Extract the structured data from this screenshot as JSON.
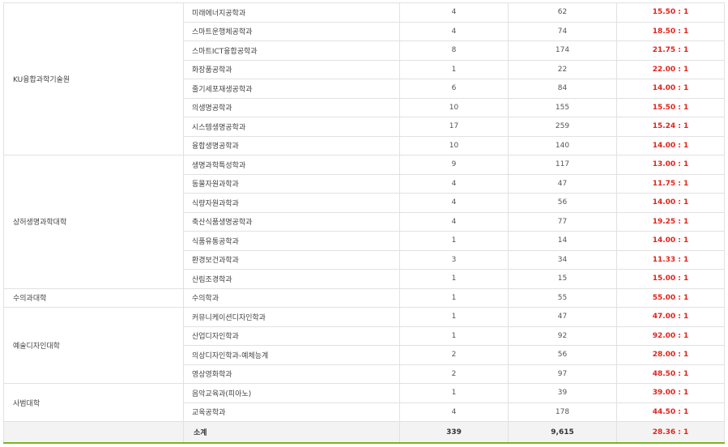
{
  "groups": [
    {
      "college": "KU융합과학기술원",
      "rows": [
        {
          "dept": "미래에너지공학과",
          "quota": "4",
          "applicants": "62",
          "ratio": "15.50 : 1"
        },
        {
          "dept": "스마트운행체공학과",
          "quota": "4",
          "applicants": "74",
          "ratio": "18.50 : 1"
        },
        {
          "dept": "스마트ICT융합공학과",
          "quota": "8",
          "applicants": "174",
          "ratio": "21.75 : 1"
        },
        {
          "dept": "화장품공학과",
          "quota": "1",
          "applicants": "22",
          "ratio": "22.00 : 1"
        },
        {
          "dept": "줄기세포재생공학과",
          "quota": "6",
          "applicants": "84",
          "ratio": "14.00 : 1"
        },
        {
          "dept": "의생명공학과",
          "quota": "10",
          "applicants": "155",
          "ratio": "15.50 : 1"
        },
        {
          "dept": "시스템생명공학과",
          "quota": "17",
          "applicants": "259",
          "ratio": "15.24 : 1"
        },
        {
          "dept": "융합생명공학과",
          "quota": "10",
          "applicants": "140",
          "ratio": "14.00 : 1"
        }
      ]
    },
    {
      "college": "상허생명과학대학",
      "rows": [
        {
          "dept": "생명과학특성학과",
          "quota": "9",
          "applicants": "117",
          "ratio": "13.00 : 1"
        },
        {
          "dept": "동물자원과학과",
          "quota": "4",
          "applicants": "47",
          "ratio": "11.75 : 1"
        },
        {
          "dept": "식량자원과학과",
          "quota": "4",
          "applicants": "56",
          "ratio": "14.00 : 1"
        },
        {
          "dept": "축산식품생명공학과",
          "quota": "4",
          "applicants": "77",
          "ratio": "19.25 : 1"
        },
        {
          "dept": "식품유통공학과",
          "quota": "1",
          "applicants": "14",
          "ratio": "14.00 : 1"
        },
        {
          "dept": "환경보건과학과",
          "quota": "3",
          "applicants": "34",
          "ratio": "11.33 : 1"
        },
        {
          "dept": "산림조경학과",
          "quota": "1",
          "applicants": "15",
          "ratio": "15.00 : 1"
        }
      ]
    },
    {
      "college": "수의과대학",
      "rows": [
        {
          "dept": "수의학과",
          "quota": "1",
          "applicants": "55",
          "ratio": "55.00 : 1"
        }
      ]
    },
    {
      "college": "예술디자인대학",
      "rows": [
        {
          "dept": "커뮤니케이션디자인학과",
          "quota": "1",
          "applicants": "47",
          "ratio": "47.00 : 1"
        },
        {
          "dept": "산업디자인학과",
          "quota": "1",
          "applicants": "92",
          "ratio": "92.00 : 1"
        },
        {
          "dept": "의상디자인학과-예체능계",
          "quota": "2",
          "applicants": "56",
          "ratio": "28.00 : 1"
        },
        {
          "dept": "영상영화학과",
          "quota": "2",
          "applicants": "97",
          "ratio": "48.50 : 1"
        }
      ]
    },
    {
      "college": "사범대학",
      "rows": [
        {
          "dept": "음악교육과(피아노)",
          "quota": "1",
          "applicants": "39",
          "ratio": "39.00 : 1"
        },
        {
          "dept": "교육공학과",
          "quota": "4",
          "applicants": "178",
          "ratio": "44.50 : 1"
        }
      ]
    }
  ],
  "total": {
    "label": "소계",
    "quota": "339",
    "applicants": "9,615",
    "ratio": "28.36 : 1"
  },
  "colors": {
    "ratio": "#e2231a",
    "border": "#e1e1e1",
    "total_bg": "#f3f3f3",
    "accent": "#7ab51d"
  }
}
